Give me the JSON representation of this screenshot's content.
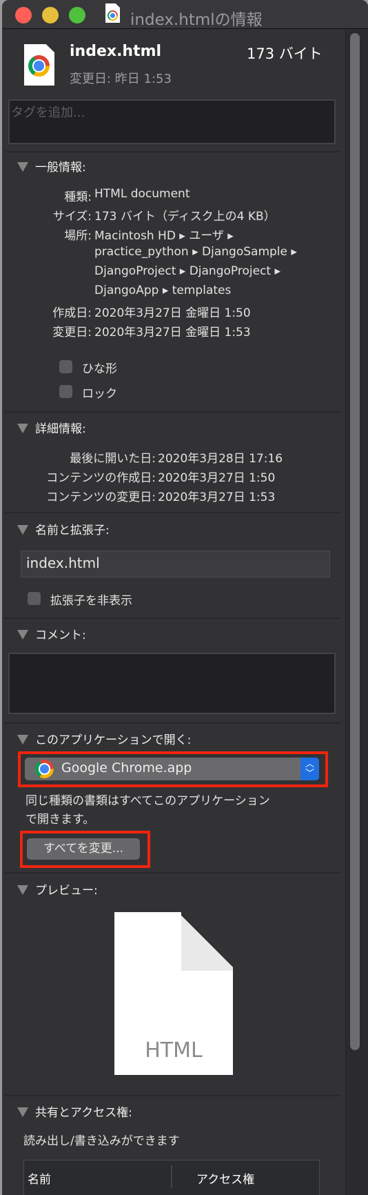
{
  "window": {
    "title": "index.htmlの情報"
  },
  "header": {
    "name": "index.html",
    "size": "173 バイト",
    "modified": "変更日: 昨日 1:53"
  },
  "tags": {
    "placeholder": "タグを追加..."
  },
  "general": {
    "heading": "一般情報:",
    "rows": [
      {
        "label": "種類:",
        "value": "HTML document"
      },
      {
        "label": "サイズ:",
        "value": "173 バイト（ディスク上の4 KB）"
      },
      {
        "label": "場所:",
        "value_lines": [
          "Macintosh HD ▸ ユーザ ▸",
          "practice_python ▸ DjangoSample ▸",
          "DjangoProject ▸ DjangoProject ▸",
          "DjangoApp ▸ templates"
        ]
      },
      {
        "label": "作成日:",
        "value": "2020年3月27日 金曜日 1:50"
      },
      {
        "label": "変更日:",
        "value": "2020年3月27日 金曜日 1:53"
      }
    ],
    "stationery": "ひな形",
    "locked": "ロック",
    "stationery_checked": false,
    "locked_checked": false
  },
  "more": {
    "heading": "詳細情報:",
    "rows": [
      {
        "label": "最後に開いた日:",
        "value": "2020年3月28日 17:16"
      },
      {
        "label": "コンテンツの作成日:",
        "value": "2020年3月27日 1:50"
      },
      {
        "label": "コンテンツの変更日:",
        "value": "2020年3月27日 1:53"
      }
    ]
  },
  "name_ext": {
    "heading": "名前と拡張子:",
    "value": "index.html",
    "hide_ext": "拡張子を非表示",
    "hide_ext_checked": false
  },
  "comments": {
    "heading": "コメント:",
    "value": ""
  },
  "open_with": {
    "heading": "このアプリケーションで開く:",
    "app": "Google Chrome.app",
    "note_lines": [
      "同じ種類の書類はすべてこのアプリケーション",
      "で開きます。"
    ],
    "change_all": "すべてを変更..."
  },
  "preview": {
    "heading": "プレビュー:",
    "doc_label": "HTML"
  },
  "sharing": {
    "heading": "共有とアクセス権:",
    "status": "読み出し/書き込みができます",
    "columns": [
      "名前",
      "アクセス権"
    ]
  },
  "colors": {
    "highlight": "#f2230e",
    "popup_arrow": "#1f6fe0"
  }
}
